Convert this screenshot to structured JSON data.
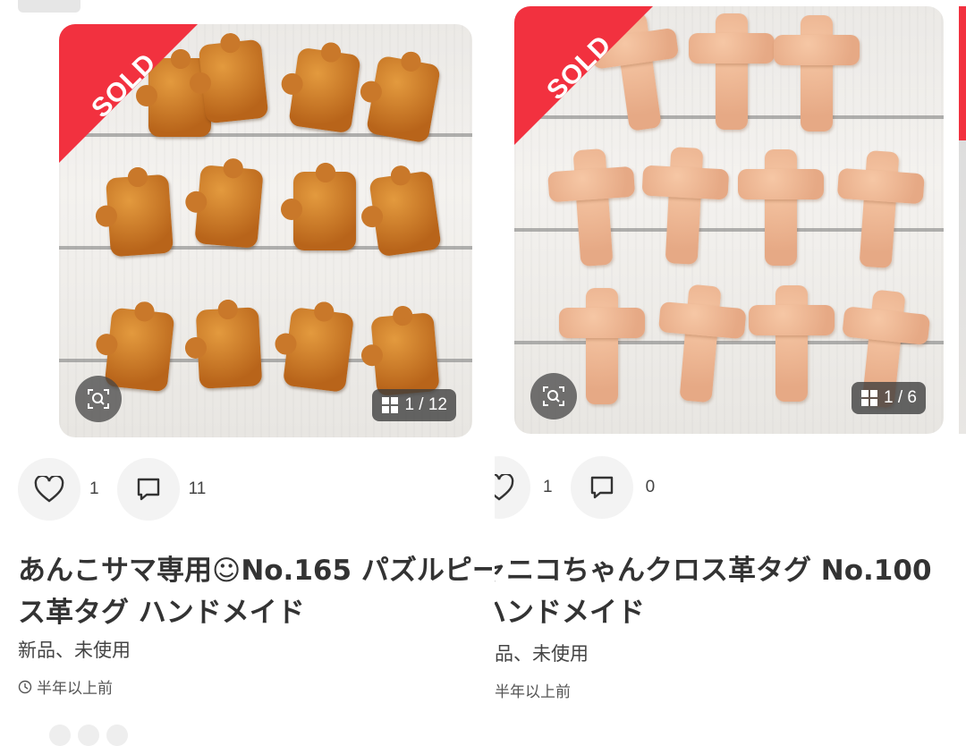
{
  "cards": [
    {
      "sold_label": "SOLD",
      "image_counter": "1 / 12",
      "likes": "1",
      "comments": "11",
      "title_line1": "あんこサマ専用☺No.165 パズルピー",
      "title_line2": "ス革タグ ハンドメイド",
      "condition": "新品、未使用",
      "posted": "半年以上前"
    },
    {
      "sold_label": "SOLD",
      "image_counter": "1 / 6",
      "likes": "1",
      "comments": "0",
      "title_line1": "ャニコちゃんクロス革タグ No.100",
      "title_line2": "ハンドメイド",
      "condition": "品、未使用",
      "posted": "半年以上前"
    }
  ],
  "colors": {
    "sold_banner": "#f2313f",
    "leather_dark": "#c9782a",
    "leather_light": "#f0b894"
  },
  "icons": [
    "image-search-icon",
    "gallery-grid-icon",
    "heart-icon",
    "comment-icon",
    "clock-icon"
  ]
}
